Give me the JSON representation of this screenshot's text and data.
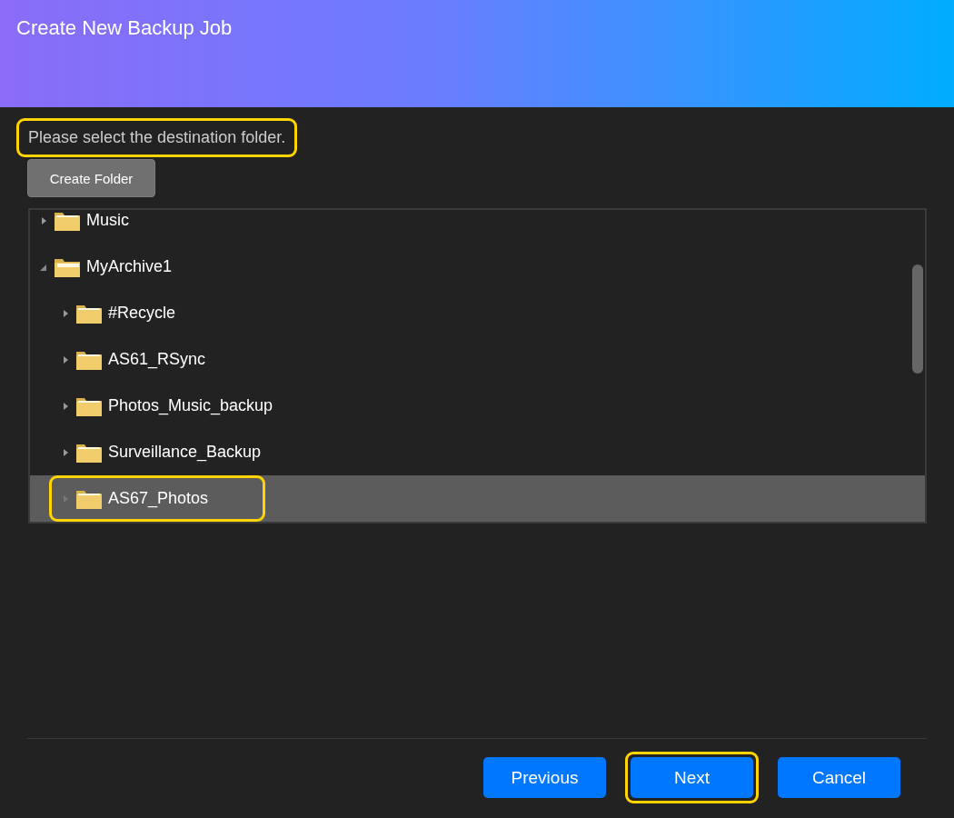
{
  "window": {
    "title": "Create New Backup Job"
  },
  "instruction": {
    "text": "Please select the destination folder.",
    "highlighted": true
  },
  "create_folder_button": "Create Folder",
  "tree": [
    {
      "label": "Music",
      "expanded": false,
      "selected": false,
      "highlighted": false
    },
    {
      "label": "MyArchive1",
      "expanded": true,
      "selected": false,
      "highlighted": false,
      "children": [
        {
          "label": "#Recycle",
          "expanded": false,
          "selected": false,
          "highlighted": false
        },
        {
          "label": "AS61_RSync",
          "expanded": false,
          "selected": false,
          "highlighted": false
        },
        {
          "label": "Photos_Music_backup",
          "expanded": false,
          "selected": false,
          "highlighted": false
        },
        {
          "label": "Surveillance_Backup",
          "expanded": false,
          "selected": false,
          "highlighted": false
        },
        {
          "label": "AS67_Photos",
          "expanded": false,
          "selected": true,
          "highlighted": true
        }
      ]
    }
  ],
  "buttons": [
    {
      "label": "Previous",
      "highlighted": false
    },
    {
      "label": "Next",
      "highlighted": true
    },
    {
      "label": "Cancel",
      "highlighted": false
    }
  ]
}
